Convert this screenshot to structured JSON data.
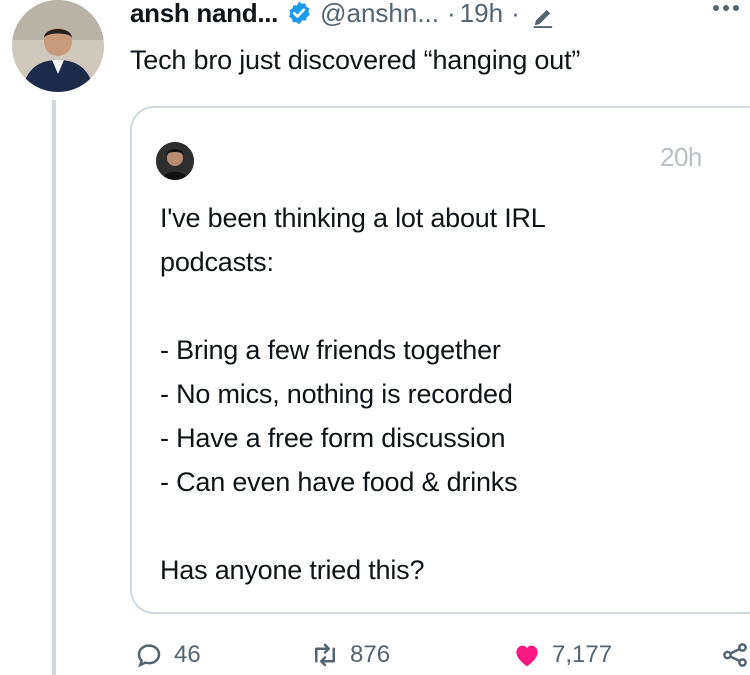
{
  "tweet": {
    "author_name": "ansh nand...",
    "handle": "@anshn...",
    "separator": "·",
    "time": "19h",
    "text": "Tech bro just discovered “hanging out”"
  },
  "quoted_tweet": {
    "time": "20h",
    "lines": [
      "I've been thinking a lot about IRL",
      "podcasts:",
      "",
      "- Bring a few friends together",
      "- No mics, nothing is recorded",
      "- Have a free form discussion",
      "- Can even have food & drinks",
      "",
      "Has anyone tried this?"
    ]
  },
  "actions": {
    "replies": "46",
    "retweets": "876",
    "likes": "7,177"
  },
  "colors": {
    "verified": "#1d9bf0",
    "like": "#f91880",
    "muted": "#536471",
    "border": "#cfd9de"
  },
  "icons": {
    "verified": "verified-badge-icon",
    "edit": "pencil-edit-icon",
    "more": "more-dots-icon",
    "reply": "reply-bubble-icon",
    "retweet": "retweet-icon",
    "like": "heart-icon",
    "share": "share-icon"
  }
}
